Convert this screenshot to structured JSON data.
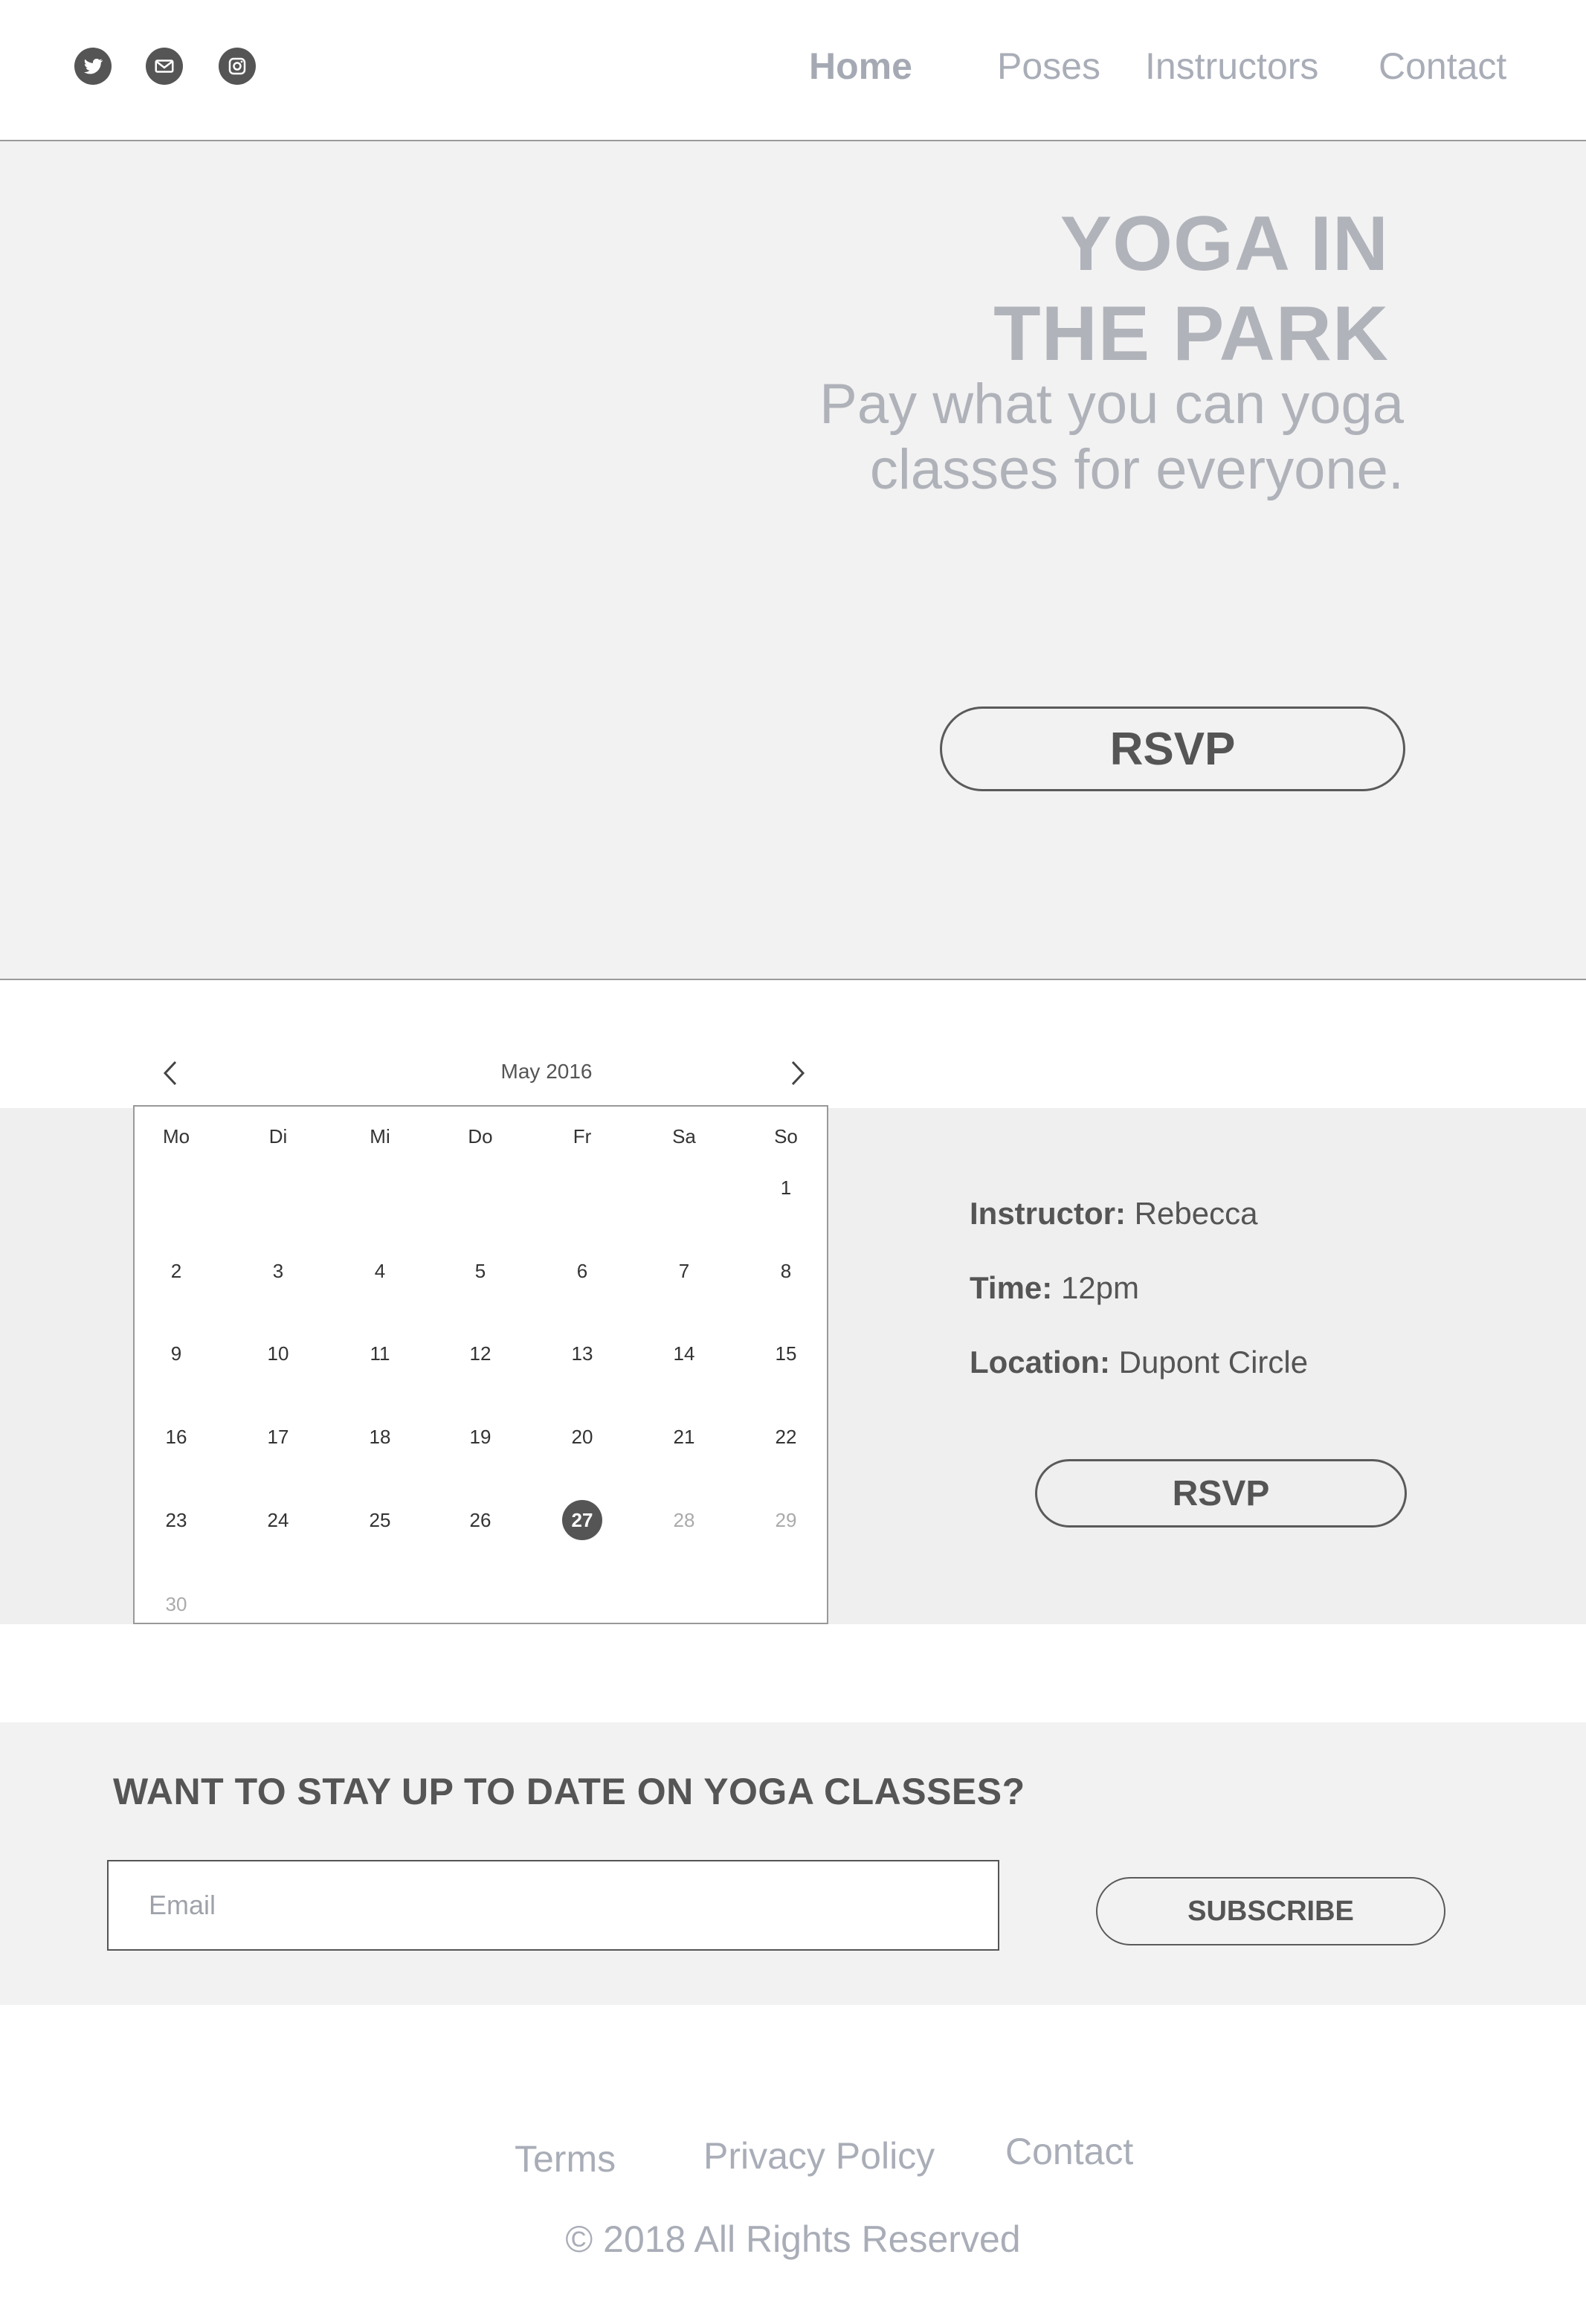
{
  "nav": {
    "social": [
      "twitter-icon",
      "mail-icon",
      "instagram-icon"
    ],
    "links": [
      "Home",
      "Poses",
      "Instructors",
      "Contact"
    ],
    "active": "Home"
  },
  "hero": {
    "title_line1": "YOGA IN",
    "title_line2": "THE PARK",
    "subtitle_line1": "Pay what you can yoga",
    "subtitle_line2": "classes for everyone.",
    "rsvp": "RSVP"
  },
  "calendar": {
    "month": "May 2016",
    "weekdays": [
      "Mo",
      "Di",
      "Mi",
      "Do",
      "Fr",
      "Sa",
      "So"
    ],
    "weeks": [
      [
        "",
        "",
        "",
        "",
        "",
        "",
        "1"
      ],
      [
        "2",
        "3",
        "4",
        "5",
        "6",
        "7",
        "8"
      ],
      [
        "9",
        "10",
        "11",
        "12",
        "13",
        "14",
        "15"
      ],
      [
        "16",
        "17",
        "18",
        "19",
        "20",
        "21",
        "22"
      ],
      [
        "23",
        "24",
        "25",
        "26",
        "27",
        "28",
        "29"
      ],
      [
        "30",
        "",
        "",
        "",
        "",
        "",
        ""
      ]
    ],
    "selected": "27",
    "faded": [
      "28",
      "29",
      "30"
    ]
  },
  "class_info": {
    "instructor_label": "Instructor:",
    "instructor": "Rebecca",
    "time_label": "Time:",
    "time": "12pm",
    "location_label": "Location:",
    "location": "Dupont Circle",
    "rsvp": "RSVP"
  },
  "newsletter": {
    "heading": "WANT TO STAY UP TO DATE ON YOGA CLASSES?",
    "email_placeholder": "Email",
    "subscribe": "SUBSCRIBE"
  },
  "footer": {
    "links": [
      "Terms",
      "Privacy Policy",
      "Contact"
    ],
    "copyright": "© 2018 All Rights Reserved"
  }
}
